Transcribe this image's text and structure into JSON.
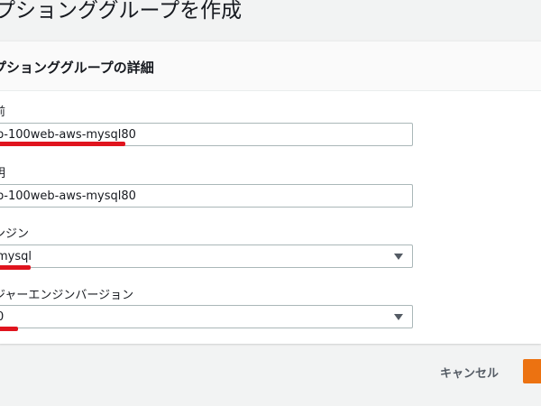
{
  "page": {
    "title": "プションググループを作成"
  },
  "panel": {
    "title": "プションググループの詳細"
  },
  "fields": {
    "name": {
      "label": "前",
      "value": "b-100web-aws-mysql80"
    },
    "description": {
      "label": "明",
      "value": "b-100web-aws-mysql80"
    },
    "engine": {
      "label": "ンジン",
      "value": "mysql"
    },
    "major_version": {
      "label": "ジャーエンジンバージョン",
      "value": "0"
    }
  },
  "footer": {
    "cancel_label": "キャンセル",
    "create_label": ""
  },
  "colors": {
    "primary": "#ec7211",
    "annotation": "#e0141e",
    "border": "#aab7b8"
  },
  "icons": {
    "dropdown": "caret-down-icon"
  }
}
